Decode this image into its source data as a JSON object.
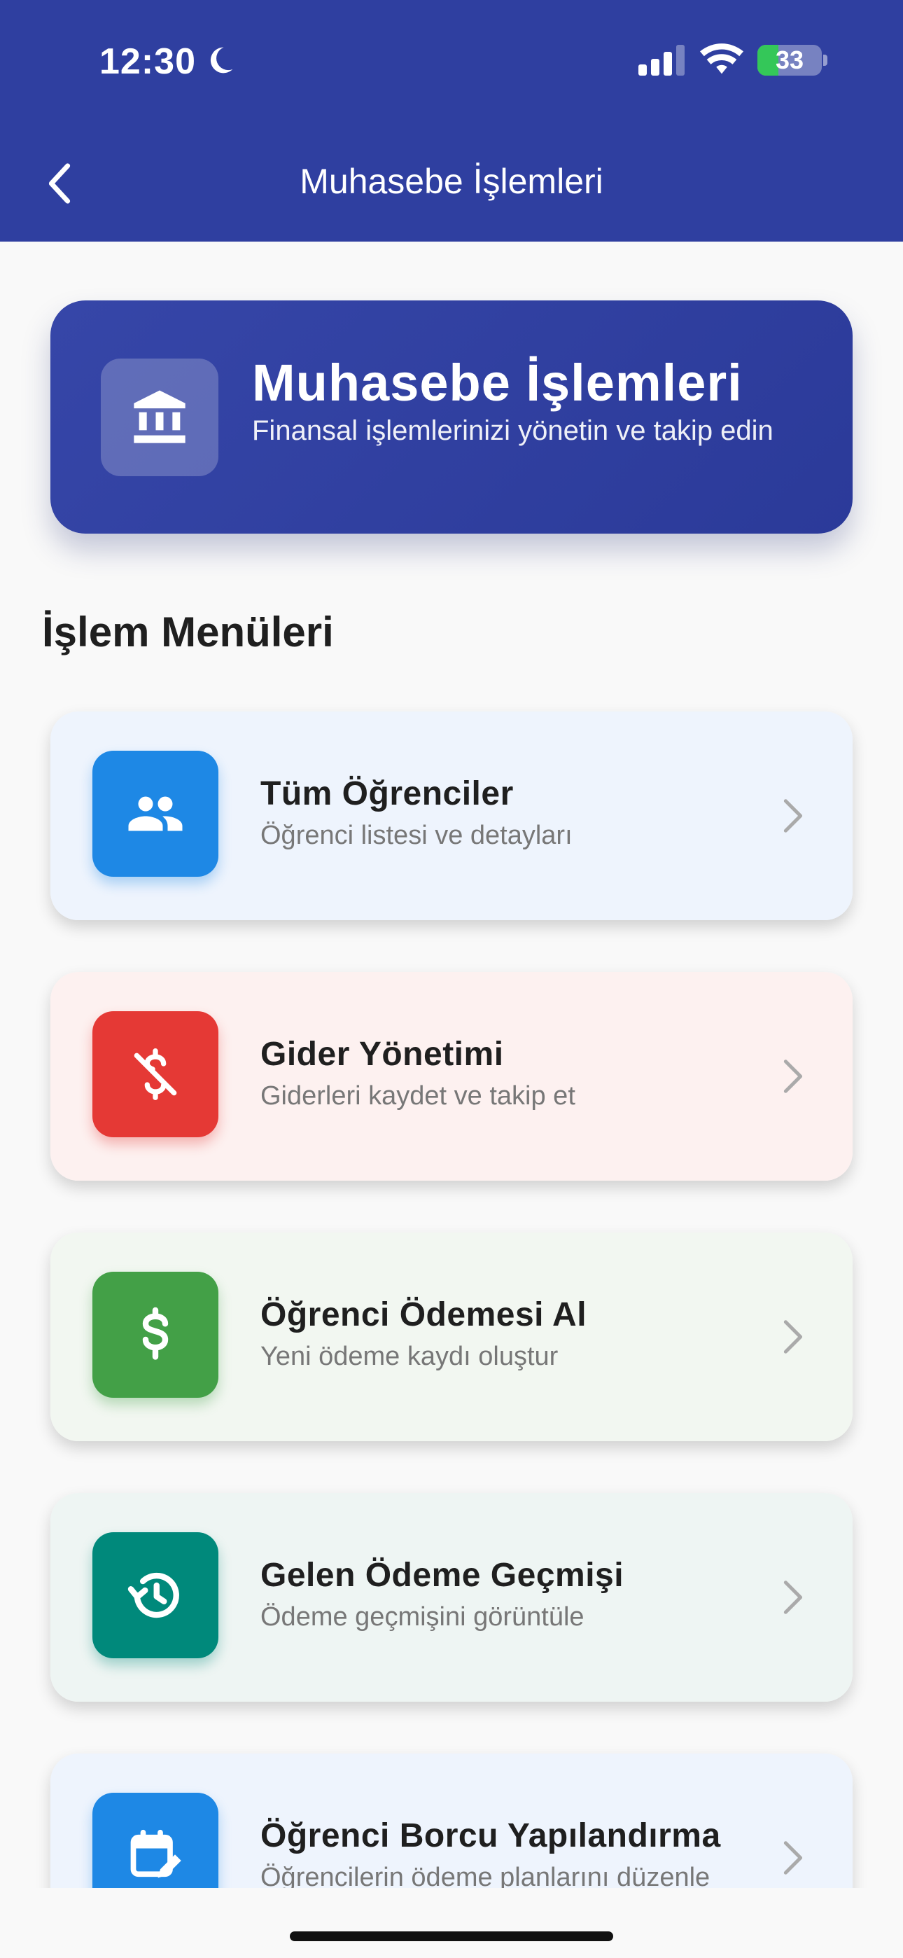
{
  "status_bar": {
    "time": "12:30",
    "battery_level": "33",
    "battery_fraction": 0.33,
    "icons": [
      "moon-icon",
      "signal-icon",
      "wifi-icon",
      "battery-icon"
    ]
  },
  "app_bar": {
    "title": "Muhasebe İşlemleri",
    "background_color": "#2f3fa0",
    "back_icon": "chevron-left-icon"
  },
  "hero": {
    "title": "Muhasebe İşlemleri",
    "subtitle": "Finansal işlemlerinizi yönetin ve takip edin",
    "icon": "bank-icon"
  },
  "section": {
    "title": "İşlem Menüleri"
  },
  "menu_items": [
    {
      "title": "Tüm Öğrenciler",
      "subtitle": "Öğrenci listesi ve detayları",
      "icon": "people-icon",
      "icon_color": "#1e88e5",
      "card_color": "#eef4fd"
    },
    {
      "title": "Gider Yönetimi",
      "subtitle": "Giderleri kaydet ve takip et",
      "icon": "money-off-icon",
      "icon_color": "#e53935",
      "card_color": "#fdf1f0"
    },
    {
      "title": "Öğrenci Ödemesi Al",
      "subtitle": "Yeni ödeme kaydı oluştur",
      "icon": "dollar-icon",
      "icon_color": "#43a047",
      "card_color": "#f2f7f1"
    },
    {
      "title": "Gelen Ödeme Geçmişi",
      "subtitle": "Ödeme geçmişini görüntüle",
      "icon": "history-icon",
      "icon_color": "#00897b",
      "card_color": "#eef5f3"
    },
    {
      "title": "Öğrenci Borcu Yapılandırma",
      "subtitle": "Öğrencilerin ödeme planlarını düzenle",
      "icon": "calendar-edit-icon",
      "icon_color": "#1e88e5",
      "card_color": "#eef4fd"
    }
  ]
}
